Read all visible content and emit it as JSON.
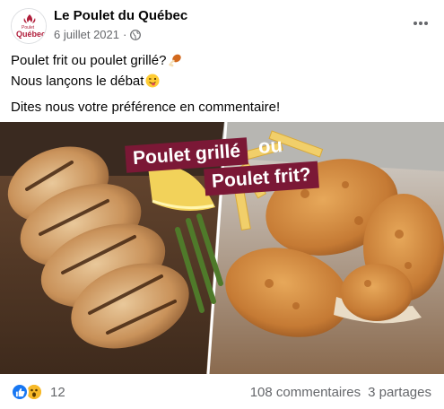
{
  "post": {
    "page_name": "Le Poulet du Québec",
    "date": "6 juillet 2021",
    "privacy_icon": "globe-icon",
    "more_icon": "ellipsis-icon",
    "avatar": {
      "logo_text_small": "Poulet",
      "logo_text_large": "Québec",
      "logo_prefix": "du",
      "brand_color": "#b01e3b"
    },
    "text": {
      "line1": "Poulet frit ou poulet grillé?",
      "line1_emoji": "drumstick-emoji",
      "line2": "Nous lançons le débat",
      "line2_emoji": "winking-tongue-emoji",
      "line3": "Dites nous votre préférence en commentaire!"
    },
    "image": {
      "banner_top": "Poulet grillé",
      "banner_ou": "ou",
      "banner_bottom": "Poulet frit?",
      "banner_color": "#7b1836"
    },
    "footer": {
      "reaction_icons": [
        "like-icon",
        "wow-icon"
      ],
      "reaction_count": "12",
      "comments": "108 commentaires",
      "shares": "3 partages"
    }
  }
}
